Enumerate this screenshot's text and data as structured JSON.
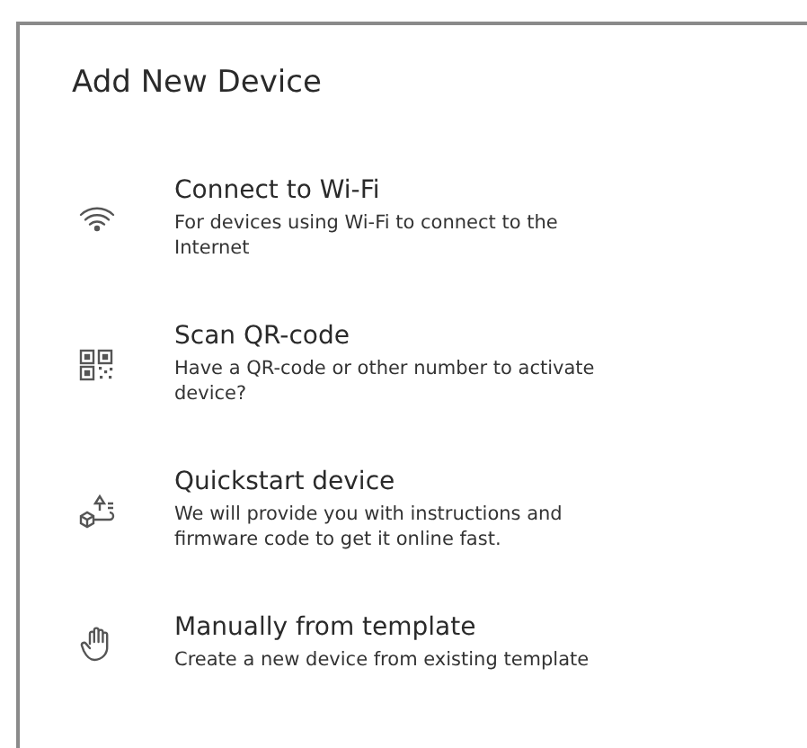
{
  "title": "Add New Device",
  "options": [
    {
      "kind": "wifi",
      "title": "Connect to Wi-Fi",
      "description": "For devices using Wi-Fi to connect to the Internet"
    },
    {
      "kind": "qr",
      "title": "Scan QR-code",
      "description": "Have a QR-code or other number to activate device?"
    },
    {
      "kind": "quickstart",
      "title": "Quickstart device",
      "description": "We will provide you with instructions and firmware code to get it online fast."
    },
    {
      "kind": "manual",
      "title": "Manually from template",
      "description": "Create a new device from existing template"
    }
  ]
}
